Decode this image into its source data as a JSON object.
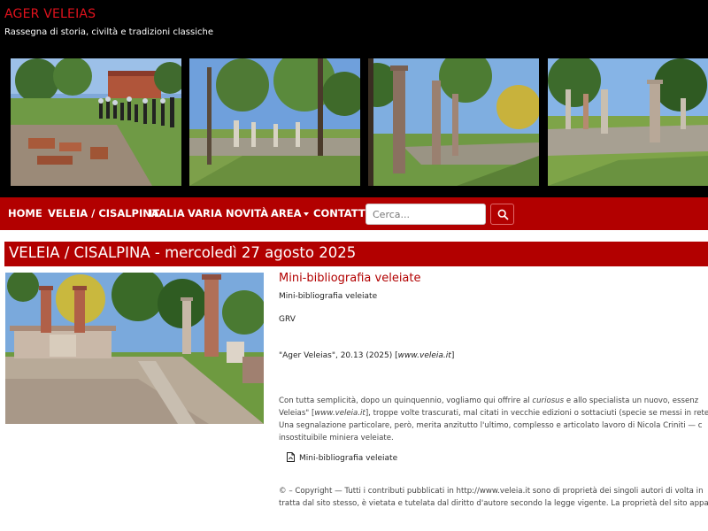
{
  "site": {
    "title": "AGER VELEIAS",
    "tagline": "Rassegna di storia, civiltà e tradizioni classiche"
  },
  "nav": {
    "items": [
      {
        "label": "HOME"
      },
      {
        "label": "VELEIA / CISALPINA"
      },
      {
        "label": "ITALIA"
      },
      {
        "label": "VARIA"
      },
      {
        "label": "NOVITÀ"
      },
      {
        "label": "AREA"
      },
      {
        "label": "CONTATTI"
      }
    ],
    "search_placeholder": "Cerca..."
  },
  "section": {
    "heading": "VELEIA / CISALPINA - mercoledì 27 agosto 2025"
  },
  "article": {
    "title": "Mini-bibliografia veleiate",
    "subtitle": "Mini-bibliografia veleiate",
    "author": "GRV",
    "citation_prefix": "\"Ager Veleias\", 20.13 (2025) [",
    "citation_link": "www.veleia.it",
    "citation_suffix": "]",
    "body_lines": [
      {
        "pre": "Con tutta semplicità, dopo un quinquennio, vogliamo qui offrire al ",
        "em": "curiosus",
        "post": " e allo specialista un nuovo, essenz"
      },
      {
        "pre": "Veleias\" [",
        "em": "www.veleia.it",
        "post": "], troppe volte trascurati, mal citati in vecchie edizioni o sottaciuti (specie se messi in rete"
      },
      {
        "pre": "Una segnalazione particolare, però, merita anzitutto l'ultimo, complesso e articolato lavoro di Nicola Criniti — c",
        "em": "",
        "post": ""
      },
      {
        "pre": "insostituibile miniera veleiate.",
        "em": "",
        "post": ""
      }
    ],
    "attachment_label": "Mini-bibliografia veleiate",
    "copyright_lines": [
      "© – Copyright — Tutti i contributi pubblicati in http://www.veleia.it sono di proprietà dei singoli autori di volta in",
      "tratta dal sito stesso, è vietata e tutelata dal diritto d'autore secondo la legge vigente. La proprietà del sito appa"
    ]
  },
  "icons": {
    "search": "search-icon",
    "attachment": "pdf-file-icon",
    "area_dropdown": "caret-down-icon"
  },
  "colors": {
    "accent": "#b20000",
    "title_red": "#e0121d",
    "header_bg": "#000000"
  }
}
